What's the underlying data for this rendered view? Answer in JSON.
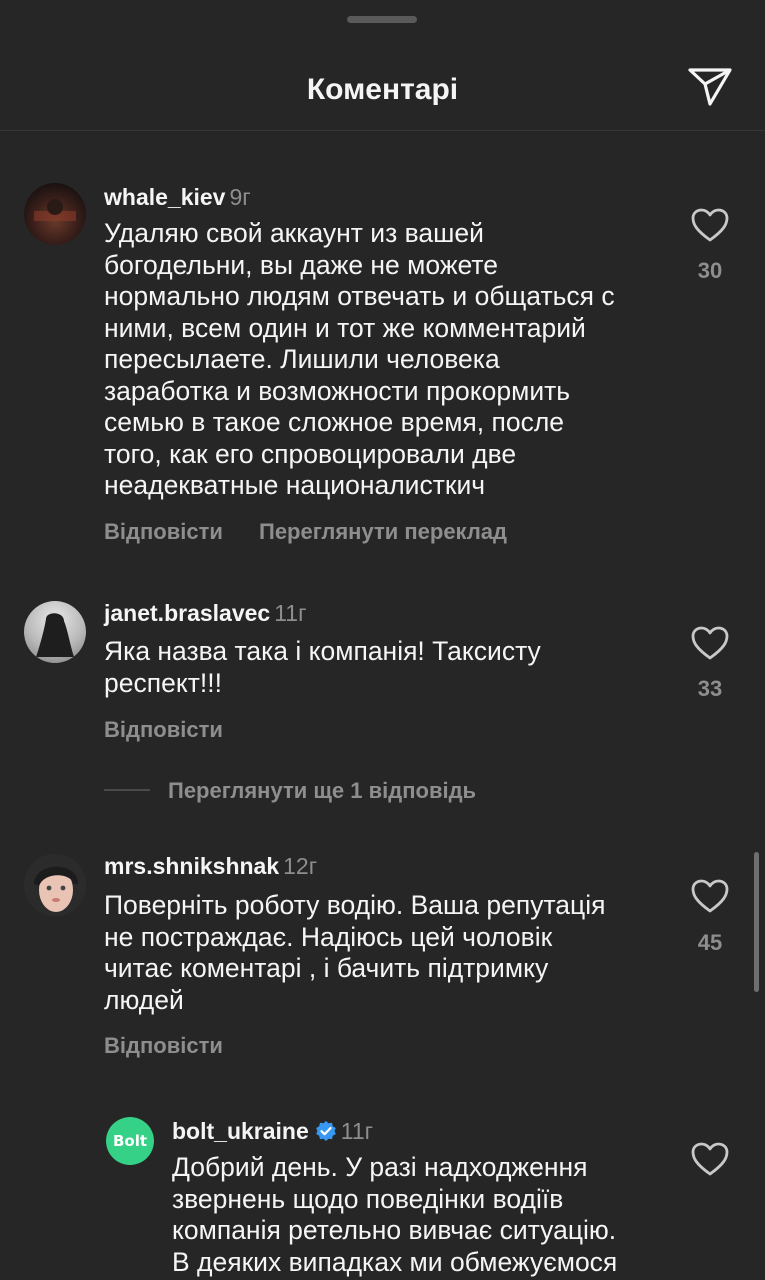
{
  "header": {
    "title": "Коментарі"
  },
  "comments": [
    {
      "username": "whale_kiev",
      "time": "9г",
      "text": "Удаляю свой аккаунт из вашей\nбогодельни, вы даже не можете\nнормально людям отвечать и общаться с\nними, всем один и тот же комментарий\nпересылаете. Лишили человека\nзаработка и возможности прокормить\nсемью в такое сложное время, после\nтого, как его спровоцировали две\nнеадекватные националисткич",
      "likes": "30",
      "reply_label": "Відповісти",
      "translate_label": "Переглянути переклад"
    },
    {
      "username": "janet.braslavec",
      "time": "11г",
      "text": "Яка назва така і компанія!  Таксисту\nреспект!!!",
      "likes": "33",
      "reply_label": "Відповісти"
    },
    {
      "username": "mrs.shnikshnak",
      "time": "12г",
      "text": "Поверніть роботу водію.  Ваша репутація\nне постраждає. Надіюсь  цей чоловік\nчитає коментарі ,  і бачить підтримку\nлюдей",
      "likes": "45",
      "reply_label": "Відповісти"
    }
  ],
  "more_replies_label": "Переглянути ще 1 відповідь",
  "reply": {
    "avatar_text": "Bolt",
    "username": "bolt_ukraine",
    "time": "11г",
    "text": "Добрий день. У разі надходження\nзвернень щодо поведінки водіїв\nкомпанія ретельно вивчає ситуацію.\nВ деяких випадках ми обмежуємося"
  },
  "colors": {
    "background": "#262626",
    "secondary_text": "#8e8e8e",
    "bolt_green": "#34d186",
    "verified_blue": "#3897f0"
  }
}
